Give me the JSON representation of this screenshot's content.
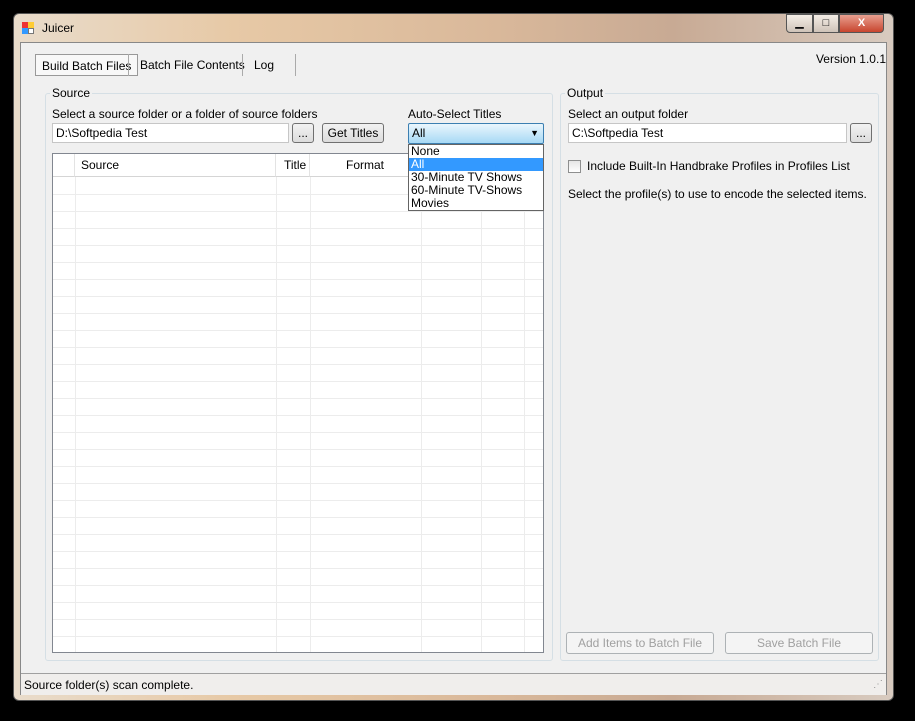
{
  "window": {
    "title": "Juicer",
    "minimize": "▁",
    "maximize": "□",
    "close": "X"
  },
  "version": "Version 1.0.1",
  "tabs": [
    {
      "label": "Build Batch Files",
      "active": true
    },
    {
      "label": "Batch File Contents"
    },
    {
      "label": "Log"
    }
  ],
  "source": {
    "group_title": "Source",
    "folder_label": "Select a source folder or a folder of source folders",
    "folder_value": "D:\\Softpedia  Test",
    "browse_label": "...",
    "get_titles_label": "Get Titles",
    "auto_select_label": "Auto-Select Titles",
    "auto_select_value": "All",
    "auto_select_options": [
      "None",
      "All",
      "30-Minute TV Shows",
      "60-Minute TV-Shows",
      "Movies"
    ],
    "grid_columns": [
      "Source",
      "Title",
      "Format",
      "",
      ""
    ]
  },
  "output": {
    "group_title": "Output",
    "folder_label": "Select an output folder",
    "folder_value": "C:\\Softpedia Test",
    "browse_label": "...",
    "include_profiles_label": "Include Built-In Handbrake Profiles in Profiles List",
    "include_profiles_checked": false,
    "profiles_hint": "Select the profile(s) to use to encode the selected items.",
    "add_items_label": "Add Items to Batch File",
    "save_label": "Save Batch File"
  },
  "status": "Source folder(s) scan complete."
}
